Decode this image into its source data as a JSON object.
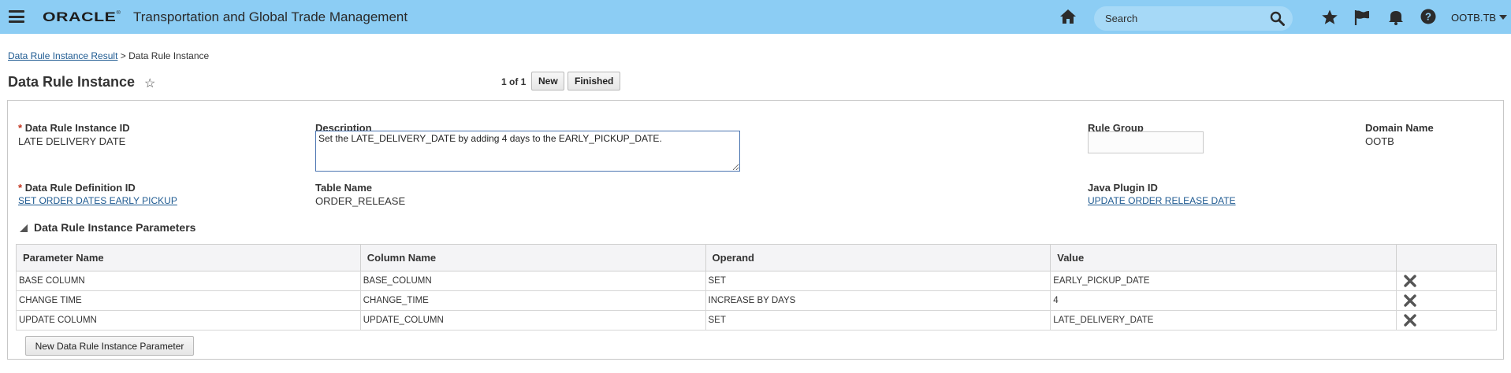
{
  "header": {
    "logo": "ORACLE",
    "logo_mark": "®",
    "app_title": "Transportation and Global Trade Management",
    "search_placeholder": "Search",
    "user": "OOTB.TB"
  },
  "breadcrumb": {
    "link": "Data Rule Instance Result",
    "separator": ">",
    "current": "Data Rule Instance"
  },
  "page": {
    "title": "Data Rule Instance",
    "pager": "1 of 1",
    "new_label": "New",
    "finished_label": "Finished"
  },
  "fields": {
    "instance_id_label": "Data Rule Instance ID",
    "instance_id_value": "LATE DELIVERY DATE",
    "description_label": "Description",
    "description_value": "Set the LATE_DELIVERY_DATE by adding 4 days to the EARLY_PICKUP_DATE.",
    "rule_group_label": "Rule Group",
    "rule_group_value": "",
    "domain_label": "Domain Name",
    "domain_value": "OOTB",
    "definition_id_label": "Data Rule Definition ID",
    "definition_id_value": "SET ORDER DATES EARLY PICKUP",
    "table_name_label": "Table Name",
    "table_name_value": "ORDER_RELEASE",
    "plugin_label": "Java Plugin ID",
    "plugin_value": "UPDATE ORDER RELEASE DATE",
    "required_marker": "*"
  },
  "params": {
    "section_title": "Data Rule Instance Parameters",
    "columns": [
      "Parameter Name",
      "Column Name",
      "Operand",
      "Value"
    ],
    "rows": [
      [
        "BASE COLUMN",
        "BASE_COLUMN",
        "SET",
        "EARLY_PICKUP_DATE"
      ],
      [
        "CHANGE TIME",
        "CHANGE_TIME",
        "INCREASE BY DAYS",
        "4"
      ],
      [
        "UPDATE COLUMN",
        "UPDATE_COLUMN",
        "SET",
        "LATE_DELIVERY_DATE"
      ]
    ],
    "new_button": "New Data Rule Instance Parameter"
  },
  "icons": {
    "menu": "hamburger-menu-icon",
    "home": "home-icon",
    "search": "search-icon",
    "favorites": "star-icon",
    "flag": "flag-icon",
    "notifications": "bell-icon",
    "help": "help-icon",
    "delete": "delete-x-icon"
  },
  "colors": {
    "topbar": "#8ccdf4",
    "link": "#1e5a91",
    "required": "#c0311b"
  }
}
